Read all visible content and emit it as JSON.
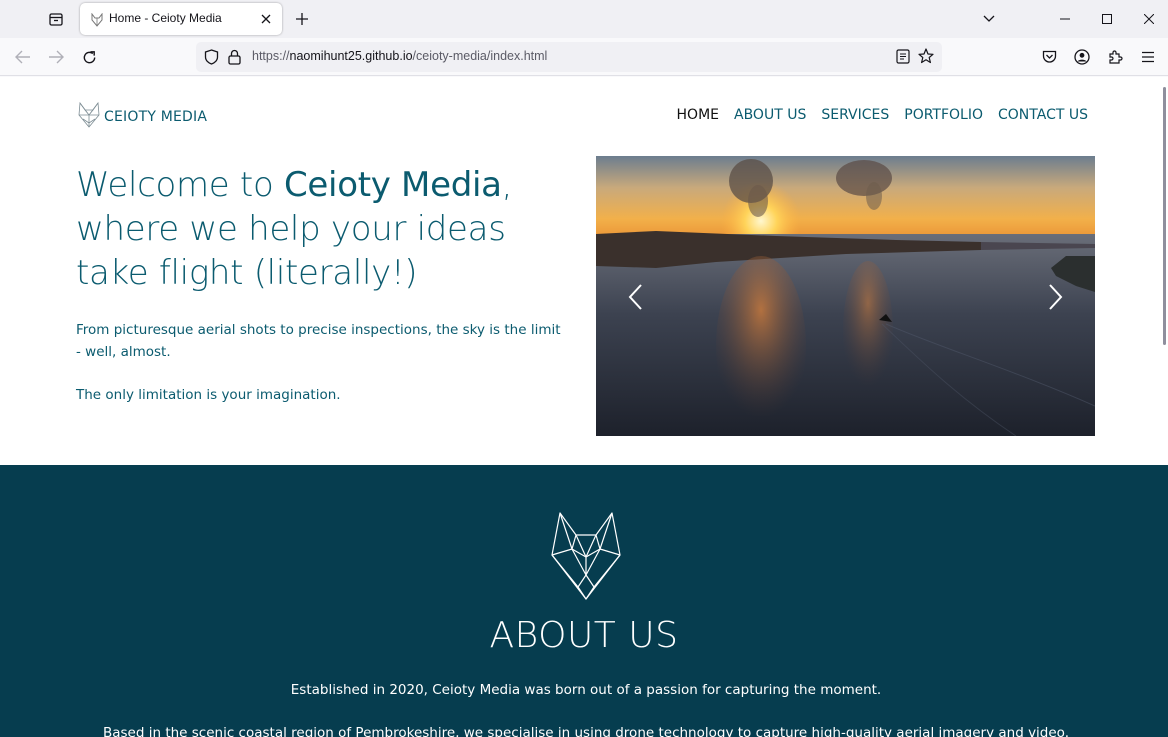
{
  "browser": {
    "tab": {
      "title": "Home - Ceioty Media",
      "favicon": "wolf-icon"
    },
    "url": {
      "scheme": "https://",
      "host": "naomihunt25.github.io",
      "path": "/ceioty-media/index.html"
    },
    "icons": [
      "tab-list-icon",
      "close-icon",
      "plus-icon",
      "chevron-down-icon",
      "minimize-icon",
      "maximize-icon",
      "back-icon",
      "forward-icon",
      "reload-icon",
      "shield-icon",
      "lock-icon",
      "reader-view-icon",
      "star-icon",
      "pocket-icon",
      "account-icon",
      "extensions-icon",
      "menu-icon"
    ]
  },
  "site": {
    "logo_text": "CEIOTY MEDIA",
    "nav": [
      {
        "label": "HOME",
        "active": true
      },
      {
        "label": "ABOUT US",
        "active": false
      },
      {
        "label": "SERVICES",
        "active": false
      },
      {
        "label": "PORTFOLIO",
        "active": false
      },
      {
        "label": "CONTACT US",
        "active": false
      }
    ],
    "hero": {
      "title_pre": "Welcome to ",
      "title_brand": "Ceioty Media",
      "title_post": ", where we help your ideas take flight (literally!)",
      "p1": "From picturesque aerial shots to precise inspections, the sky is the limit - well, almost.",
      "p2": "The only limitation is your imagination."
    },
    "about": {
      "title": "ABOUT US",
      "p1": "Established in 2020, Ceioty Media was born out of a passion for capturing the moment.",
      "p2": "Based in the scenic coastal region of Pembrokeshire, we specialise in using drone technology to capture high-quality aerial imagery and video."
    }
  },
  "colors": {
    "brand_teal": "#0b5b6f",
    "about_bg": "#063d4f",
    "nav_active": "#111111"
  }
}
